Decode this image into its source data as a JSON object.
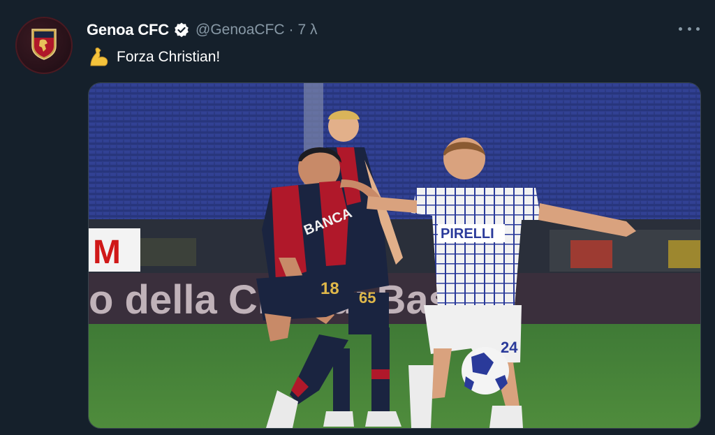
{
  "tweet": {
    "display_name": "Genoa CFC",
    "handle": "@GenoaCFC",
    "separator": "·",
    "time": "7 λ",
    "text": "Forza Christian!",
    "emoji_icon": "flexed-biceps-icon",
    "verified_icon": "verified-badge-icon",
    "more_icon": "more-options-icon",
    "media": {
      "board_text": "o della Città di Bas",
      "board_logo_text": "M",
      "sponsor_left": "BANCA",
      "sponsor_right": "PIRELLI",
      "number_18": "18",
      "number_65": "65",
      "number_24": "24"
    }
  },
  "colors": {
    "background": "#15202b",
    "secondary_text": "#8899a6",
    "verified": "#ffffff",
    "genoa_red": "#b0182a",
    "genoa_navy": "#1a2440"
  }
}
